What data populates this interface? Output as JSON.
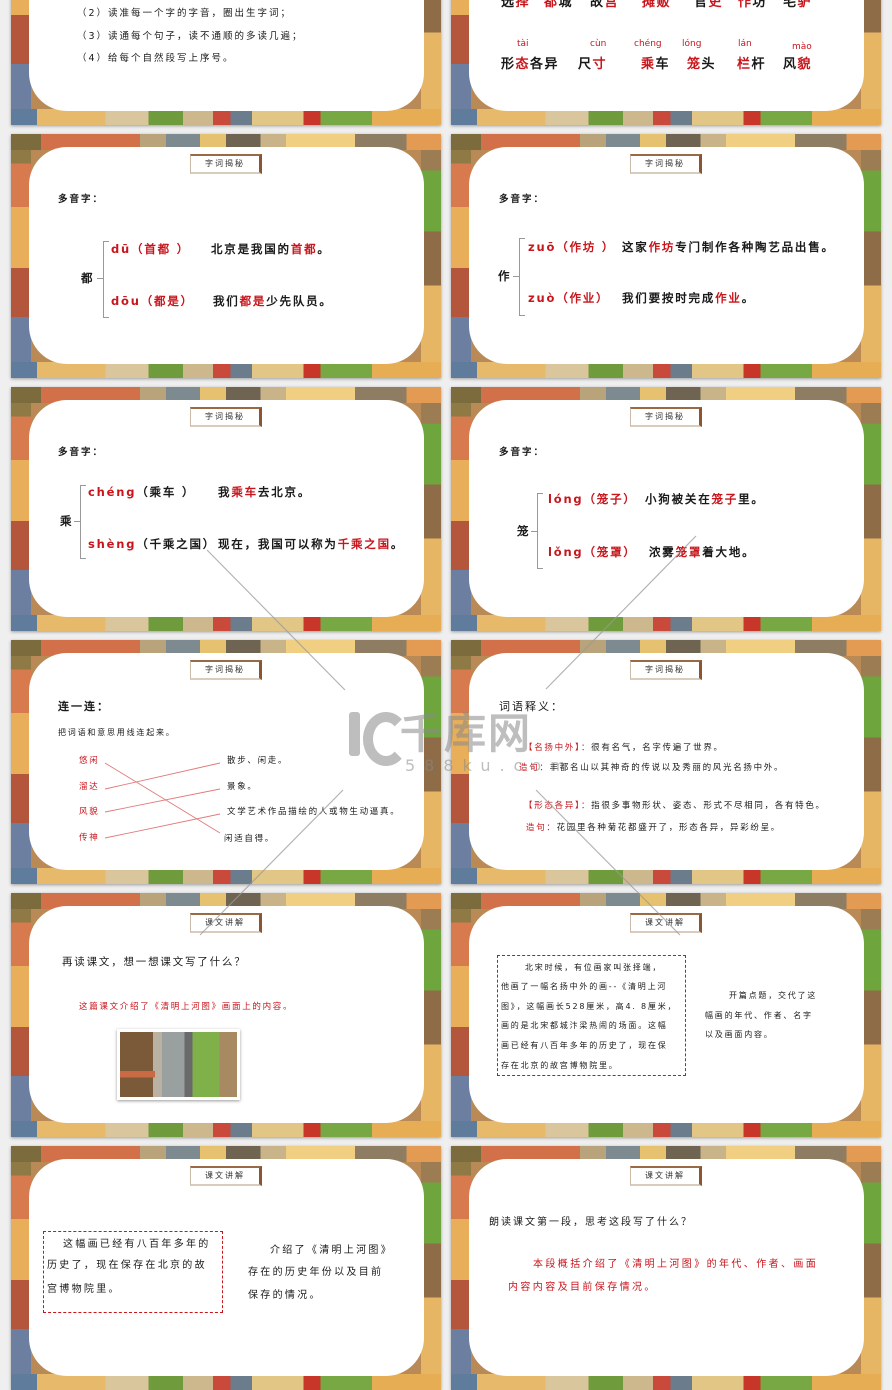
{
  "colors": {
    "accent_red": "#c8161d",
    "text": "#1a1a1a",
    "badge_edge": "#8a5532",
    "match_line": "#e07a7a"
  },
  "watermark": {
    "brand": "千库网",
    "url": "588ku.com"
  },
  "slide_reading_steps": {
    "lines": [
      "（2）读准每一个字的字音，圈出生字词；",
      "（3）读通每个句子，读不通顺的多读几遍；",
      "（4）给每个自然段写上序号。"
    ]
  },
  "slide_vocab": {
    "row1": [
      {
        "pre": "选",
        "red": "择",
        "post": ""
      },
      {
        "pre": "",
        "red": "都",
        "post": "城"
      },
      {
        "pre": "故",
        "red": "宫",
        "post": ""
      },
      {
        "pre": "",
        "red": "摊贩",
        "post": ""
      },
      {
        "pre": "官",
        "red": "吏",
        "post": ""
      },
      {
        "pre": "",
        "red": "作",
        "post": "坊"
      },
      {
        "pre": "毛",
        "red": "驴",
        "post": ""
      }
    ],
    "pinyin": [
      "tài",
      "cùn",
      "chéng",
      "lóng",
      "lán",
      "mào"
    ],
    "row2": [
      {
        "pre": "形",
        "red": "态",
        "post": "各异"
      },
      {
        "pre": "尺",
        "red": "寸",
        "post": ""
      },
      {
        "pre": "",
        "red": "乘",
        "post": "车"
      },
      {
        "pre": "",
        "red": "笼",
        "post": "头"
      },
      {
        "pre": "",
        "red": "栏",
        "post": "杆"
      },
      {
        "pre": "风",
        "red": "貌",
        "post": ""
      }
    ]
  },
  "slide_du": {
    "badge": "字词揭秘",
    "heading": "多音字：",
    "char": "都",
    "readings": [
      {
        "pinyin": "dū",
        "word": "（首都 ）",
        "word_red": true,
        "sentence": {
          "pre": "北京是我国的",
          "red": "首都",
          "post": "。"
        }
      },
      {
        "pinyin": "dōu",
        "word": "（都是）",
        "word_red": true,
        "sentence": {
          "pre": "我们",
          "red": "都是",
          "post": "少先队员。"
        }
      }
    ]
  },
  "slide_zuo": {
    "badge": "字词揭秘",
    "heading": "多音字：",
    "char": "作",
    "readings": [
      {
        "pinyin": "zuō",
        "word": "（作坊 ）",
        "word_red": true,
        "sentence": {
          "pre": "这家",
          "red": "作坊",
          "post": "专门制作各种陶艺品出售。"
        }
      },
      {
        "pinyin": "zuò",
        "word": "（作业）",
        "word_red": true,
        "sentence": {
          "pre": "我们要按时完成",
          "red": "作业",
          "post": "。"
        }
      }
    ]
  },
  "slide_cheng": {
    "badge": "字词揭秘",
    "heading": "多音字：",
    "char": "乘",
    "readings": [
      {
        "pinyin": "chéng",
        "word": "（乘车 ）",
        "word_red": false,
        "sentence": {
          "pre": "我",
          "red": "乘车",
          "post": "去北京。"
        }
      },
      {
        "pinyin": "shèng",
        "word": "（千乘之国）",
        "word_red": false,
        "sentence": {
          "pre": "现在，我国可以称为",
          "red": "千乘之国",
          "post": "。"
        }
      }
    ]
  },
  "slide_long": {
    "badge": "字词揭秘",
    "heading": "多音字：",
    "char": "笼",
    "readings": [
      {
        "pinyin": "lóng",
        "word": "（笼子）",
        "word_red": true,
        "sentence": {
          "pre": "小狗被关在",
          "red": "笼子",
          "post": "里。"
        }
      },
      {
        "pinyin": "lǒng",
        "word": "（笼罩）",
        "word_red": true,
        "sentence": {
          "pre": "浓雾",
          "red": "笼罩",
          "post": "着大地。"
        }
      }
    ]
  },
  "slide_match": {
    "badge": "字词揭秘",
    "heading": "连一连：",
    "instruction": "把词语和意思用线连起来。",
    "words": [
      "悠闲",
      "溜达",
      "风貌",
      "传神"
    ],
    "meanings": [
      "散步、闲走。",
      "景象。",
      "文学艺术作品描绘的人或物生动逼真。",
      "闲适自得。"
    ],
    "connections": [
      [
        0,
        3
      ],
      [
        1,
        0
      ],
      [
        2,
        1
      ],
      [
        3,
        2
      ]
    ]
  },
  "slide_definitions": {
    "badge": "字词揭秘",
    "heading": "词语释义：",
    "entries": [
      {
        "term": "【名扬中外】：",
        "definition": "很有名气，名字传遍了世界。",
        "example_label": "造句：",
        "example": "丰都名山以其神奇的传说以及秀丽的风光名扬中外。"
      },
      {
        "term": "【形态各异】：",
        "definition": "指很多事物形状、姿态、形式不尽相同，各有特色。",
        "example_label": "造句：",
        "example": "花园里各种菊花都盛开了，形态各异，异彩纷呈。"
      }
    ]
  },
  "slide_reread": {
    "badge": "课文讲解",
    "question": "再读课文，想一想课文写了什么？",
    "answer": "这篇课文介绍了《清明上河图》画面上的内容。"
  },
  "slide_para1": {
    "badge": "课文讲解",
    "passage_lines": [
      "北宋时候，有位画家叫张择端，",
      "他画了一幅名扬中外的画--《清明上河",
      "图》，这幅画长528厘米，高4. 8厘米，",
      "画的是北宋都城汴梁热闹的场面。这幅",
      "画已经有八百年多年的历史了，现在保",
      "存在北京的故宫博物院里。"
    ],
    "note_lines": [
      "开篇点题，交代了这",
      "幅画的年代、作者、名字",
      "以及画面内容。"
    ]
  },
  "slide_para1_end": {
    "badge": "课文讲解",
    "passage_lines": [
      "这幅画已经有八百年多年的",
      "历史了，现在保存在北京的故",
      "宫博物院里。"
    ],
    "note_lines": [
      "介绍了《清明上河图》",
      "存在的历史年份以及目前",
      "保存的情况。"
    ]
  },
  "slide_read_first": {
    "badge": "课文讲解",
    "question": "朗读课文第一段，思考这段写了什么？",
    "answer_lines": [
      "本段概括介绍了《清明上河图》的年代、作者、画面",
      "内容内容及目前保存情况。"
    ]
  }
}
